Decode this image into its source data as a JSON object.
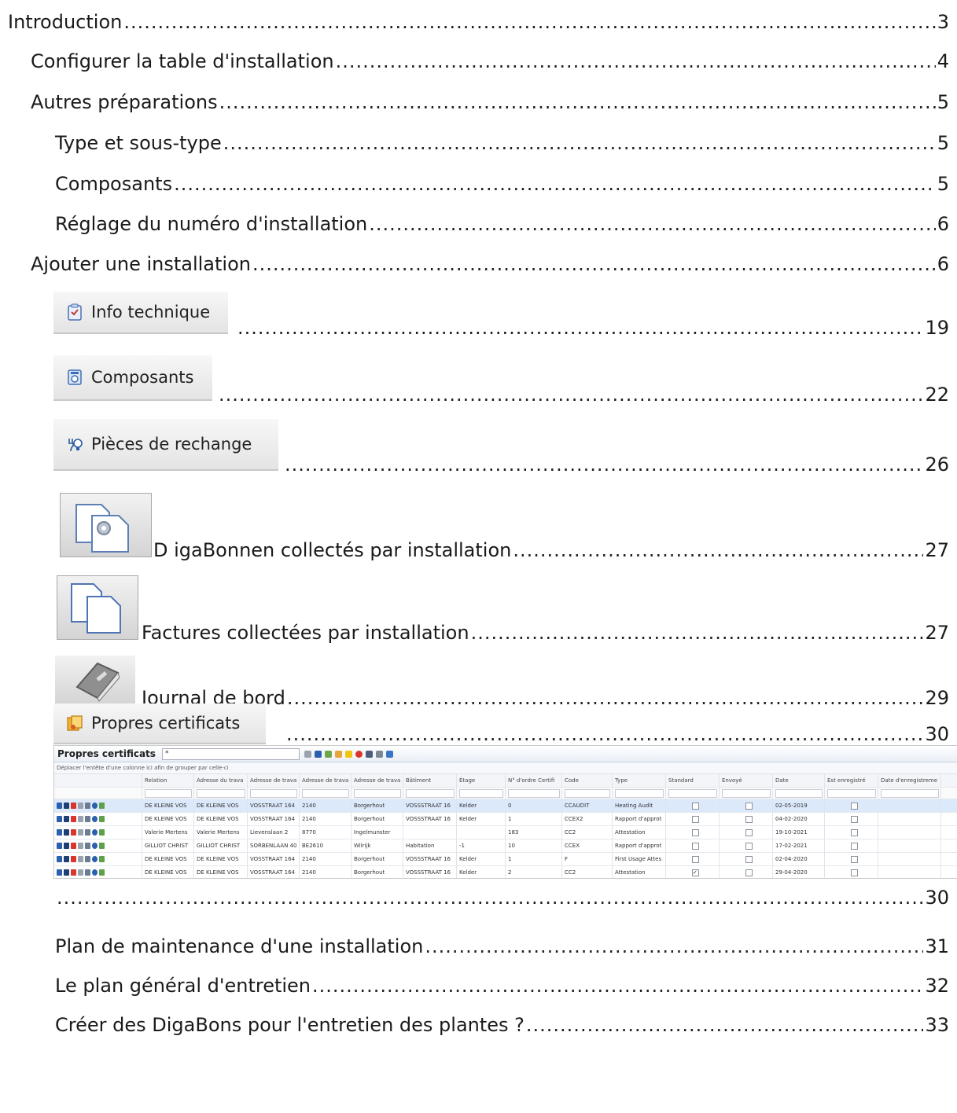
{
  "toc": [
    {
      "title": "Introduction",
      "page": "3"
    },
    {
      "title": "Configurer la table d'installation",
      "page": "4"
    },
    {
      "title": "Autres préparations",
      "page": "5"
    },
    {
      "title": "Type et sous-type",
      "page": "5"
    },
    {
      "title": "Composants",
      "page": "5"
    },
    {
      "title": "Réglage du numéro d'installation",
      "page": "6"
    },
    {
      "title": "Ajouter une installation",
      "page": "6"
    },
    {
      "title": "",
      "page": "19",
      "button": "Info technique",
      "icon": "clipboard-check-icon"
    },
    {
      "title": "",
      "page": "22",
      "button": "Composants",
      "icon": "component-box-icon"
    },
    {
      "title": "",
      "page": "26",
      "button": "Pièces de rechange",
      "icon": "plug-bulb-icon"
    },
    {
      "title": "D igaBonnen collectés par installation",
      "page": "27",
      "icon": "document-gear-icon"
    },
    {
      "title": "Factures collectées par installation",
      "page": "27",
      "icon": "documents-copy-icon"
    },
    {
      "title": "Journal de bord",
      "page": "29",
      "icon": "logbook-icon"
    },
    {
      "title": "",
      "page": "30",
      "button": "Propres certificats",
      "icon": "certificate-icon"
    },
    {
      "title": "",
      "page": "30"
    },
    {
      "title": "Plan de maintenance d'une installation",
      "page": "31"
    },
    {
      "title": "Le plan général d'entretien",
      "page": "32"
    },
    {
      "title": "Créer des DigaBons pour l'entretien des plantes ?",
      "page": "33"
    }
  ],
  "grid": {
    "title": "Propres certificats",
    "search": "*",
    "group_hint": "Déplacer l'entête d'une colonne ici afin de grouper par celle-ci",
    "columns": [
      "Relation",
      "Adresse du trava",
      "Adresse de trava",
      "Adresse de trava",
      "Adresse de trava",
      "Bâtiment",
      "Étage",
      "N° d'ordre Certifi",
      "Code",
      "Type",
      "Standard",
      "Envoyé",
      "Date",
      "Est enregistré",
      "Date d'enregistreme"
    ],
    "rows": [
      {
        "cells": [
          "DE KLEINE VOS",
          "DE KLEINE VOS",
          "VOSSTRAAT 164",
          "2140",
          "Borgerhout",
          "VOSSSTRAAT 16",
          "Kelder",
          "0",
          "CCAUDIT",
          "Heating Audit",
          "",
          "",
          "02-05-2019",
          "",
          ""
        ],
        "standard": false,
        "selected": true
      },
      {
        "cells": [
          "DE KLEINE VOS",
          "DE KLEINE VOS",
          "VOSSTRAAT 164",
          "2140",
          "Borgerhout",
          "VOSSSTRAAT 16",
          "Kelder",
          "1",
          "CCEX2",
          "Rapport d'approt",
          "",
          "",
          "04-02-2020",
          "",
          ""
        ],
        "standard": false
      },
      {
        "cells": [
          "Valerie Mertens",
          "Valerie Mertens",
          "Lievenslaan 2",
          "8770",
          "Ingelmunster",
          "",
          "",
          "183",
          "CC2",
          "Attestation",
          "",
          "",
          "19-10-2021",
          "",
          ""
        ],
        "standard": false
      },
      {
        "cells": [
          "GILLIOT CHRIST",
          "GILLIOT CHRIST",
          "SORBENLAAN 40",
          "BE2610",
          "Wilrijk",
          "Habitation",
          "-1",
          "10",
          "CCEX",
          "Rapport d'approt",
          "",
          "",
          "17-02-2021",
          "",
          ""
        ],
        "standard": false
      },
      {
        "cells": [
          "DE KLEINE VOS",
          "DE KLEINE VOS",
          "VOSSTRAAT 164",
          "2140",
          "Borgerhout",
          "VOSSSTRAAT 16",
          "Kelder",
          "1",
          "F",
          "First Usage Attes",
          "",
          "",
          "02-04-2020",
          "",
          ""
        ],
        "standard": false
      },
      {
        "cells": [
          "DE KLEINE VOS",
          "DE KLEINE VOS",
          "VOSSTRAAT 164",
          "2140",
          "Borgerhout",
          "VOSSSTRAAT 16",
          "Kelder",
          "2",
          "CC2",
          "Attestation",
          "",
          "",
          "29-04-2020",
          "",
          ""
        ],
        "standard": true
      }
    ]
  }
}
